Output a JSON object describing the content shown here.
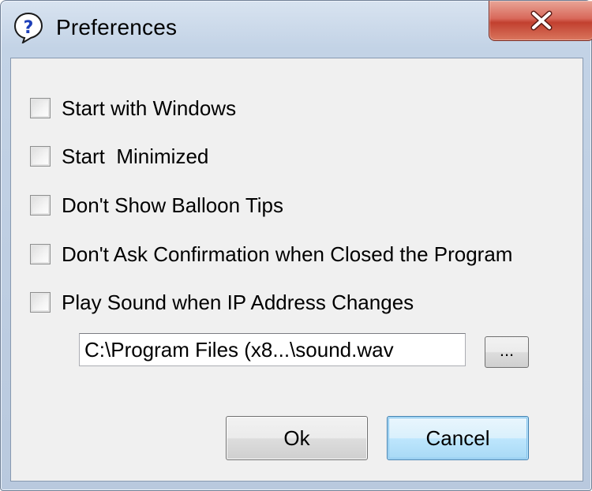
{
  "window": {
    "title": "Preferences",
    "icon": "help-question-icon",
    "close_icon": "close-x-icon"
  },
  "options": [
    {
      "label": "Start with Windows",
      "checked": false
    },
    {
      "label": "Start  Minimized",
      "checked": false
    },
    {
      "label": "Don't Show Balloon Tips",
      "checked": false
    },
    {
      "label": "Don't Ask Confirmation when Closed the Program",
      "checked": false
    },
    {
      "label": "Play Sound when IP Address Changes",
      "checked": false
    }
  ],
  "sound": {
    "path_value": "C:\\Program Files (x8...\\sound.wav",
    "browse_label": "..."
  },
  "buttons": {
    "ok_label": "Ok",
    "cancel_label": "Cancel"
  },
  "colors": {
    "close_red": "#c2402f",
    "default_button_blue": "#3c7fb1",
    "dialog_bg": "#f0f0f0"
  }
}
